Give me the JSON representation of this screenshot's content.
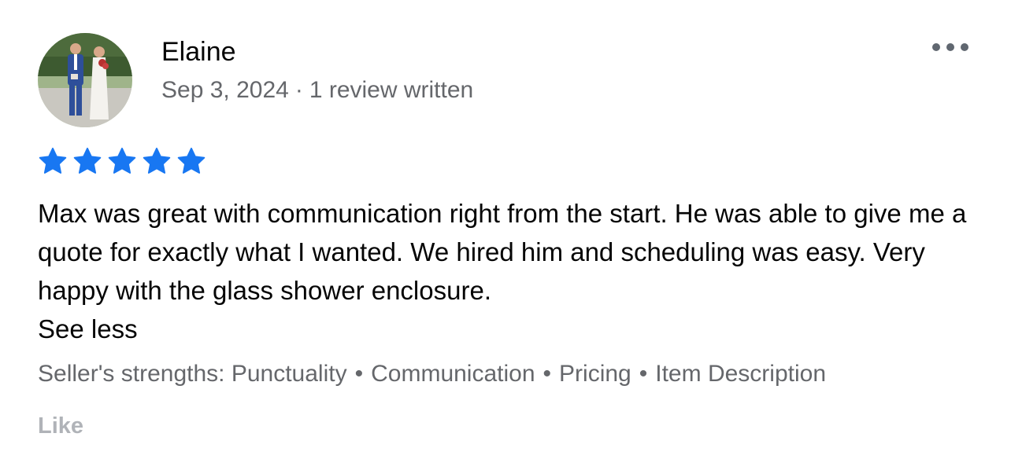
{
  "review": {
    "author": "Elaine",
    "date": "Sep 3, 2024",
    "separator": "·",
    "review_count": "1 review written",
    "rating": 5,
    "rating_max": 5,
    "text": "Max was great with communication right from the start. He was able to give me a quote for exactly what I wanted. We hired him and scheduling was easy. Very happy with the glass shower enclosure.",
    "see_less_label": "See less",
    "strengths_label": "Seller's strengths:",
    "strengths": [
      "Punctuality",
      "Communication",
      "Pricing",
      "Item Description"
    ],
    "like_label": "Like"
  },
  "icons": {
    "more": "more-options-icon",
    "star": "star-icon",
    "avatar": "avatar-photo"
  },
  "colors": {
    "star": "#1877f2",
    "text_primary": "#050505",
    "text_secondary": "#65676b",
    "like_disabled": "#b0b3b8"
  }
}
